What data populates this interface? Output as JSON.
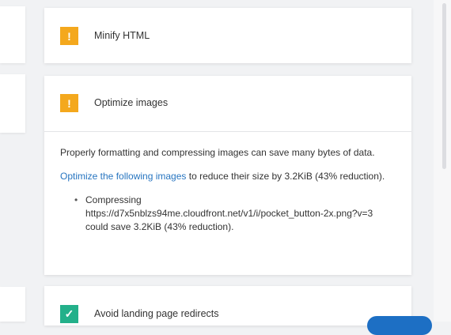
{
  "audits": [
    {
      "status": "warn",
      "icon": "warning-icon",
      "glyph": "!",
      "title": "Minify HTML"
    },
    {
      "status": "warn",
      "icon": "warning-icon",
      "glyph": "!",
      "title": "Optimize images",
      "description": "Properly formatting and compressing images can save many bytes of data.",
      "summary_link": "Optimize the following images",
      "summary_rest": " to reduce their size by 3.2KiB (43% reduction).",
      "items": [
        {
          "label": "Compressing",
          "url": "https://d7x5nblzs94me.cloudfront.net/v1/i/pocket_button-2x.png?v=3",
          "saving": "could save 3.2KiB (43% reduction)."
        }
      ]
    },
    {
      "status": "ok",
      "icon": "check-icon",
      "glyph": "✓",
      "title": "Avoid landing page redirects"
    }
  ],
  "colors": {
    "warning": "#f4a81d",
    "success": "#23b08a",
    "link": "#2775c0"
  }
}
